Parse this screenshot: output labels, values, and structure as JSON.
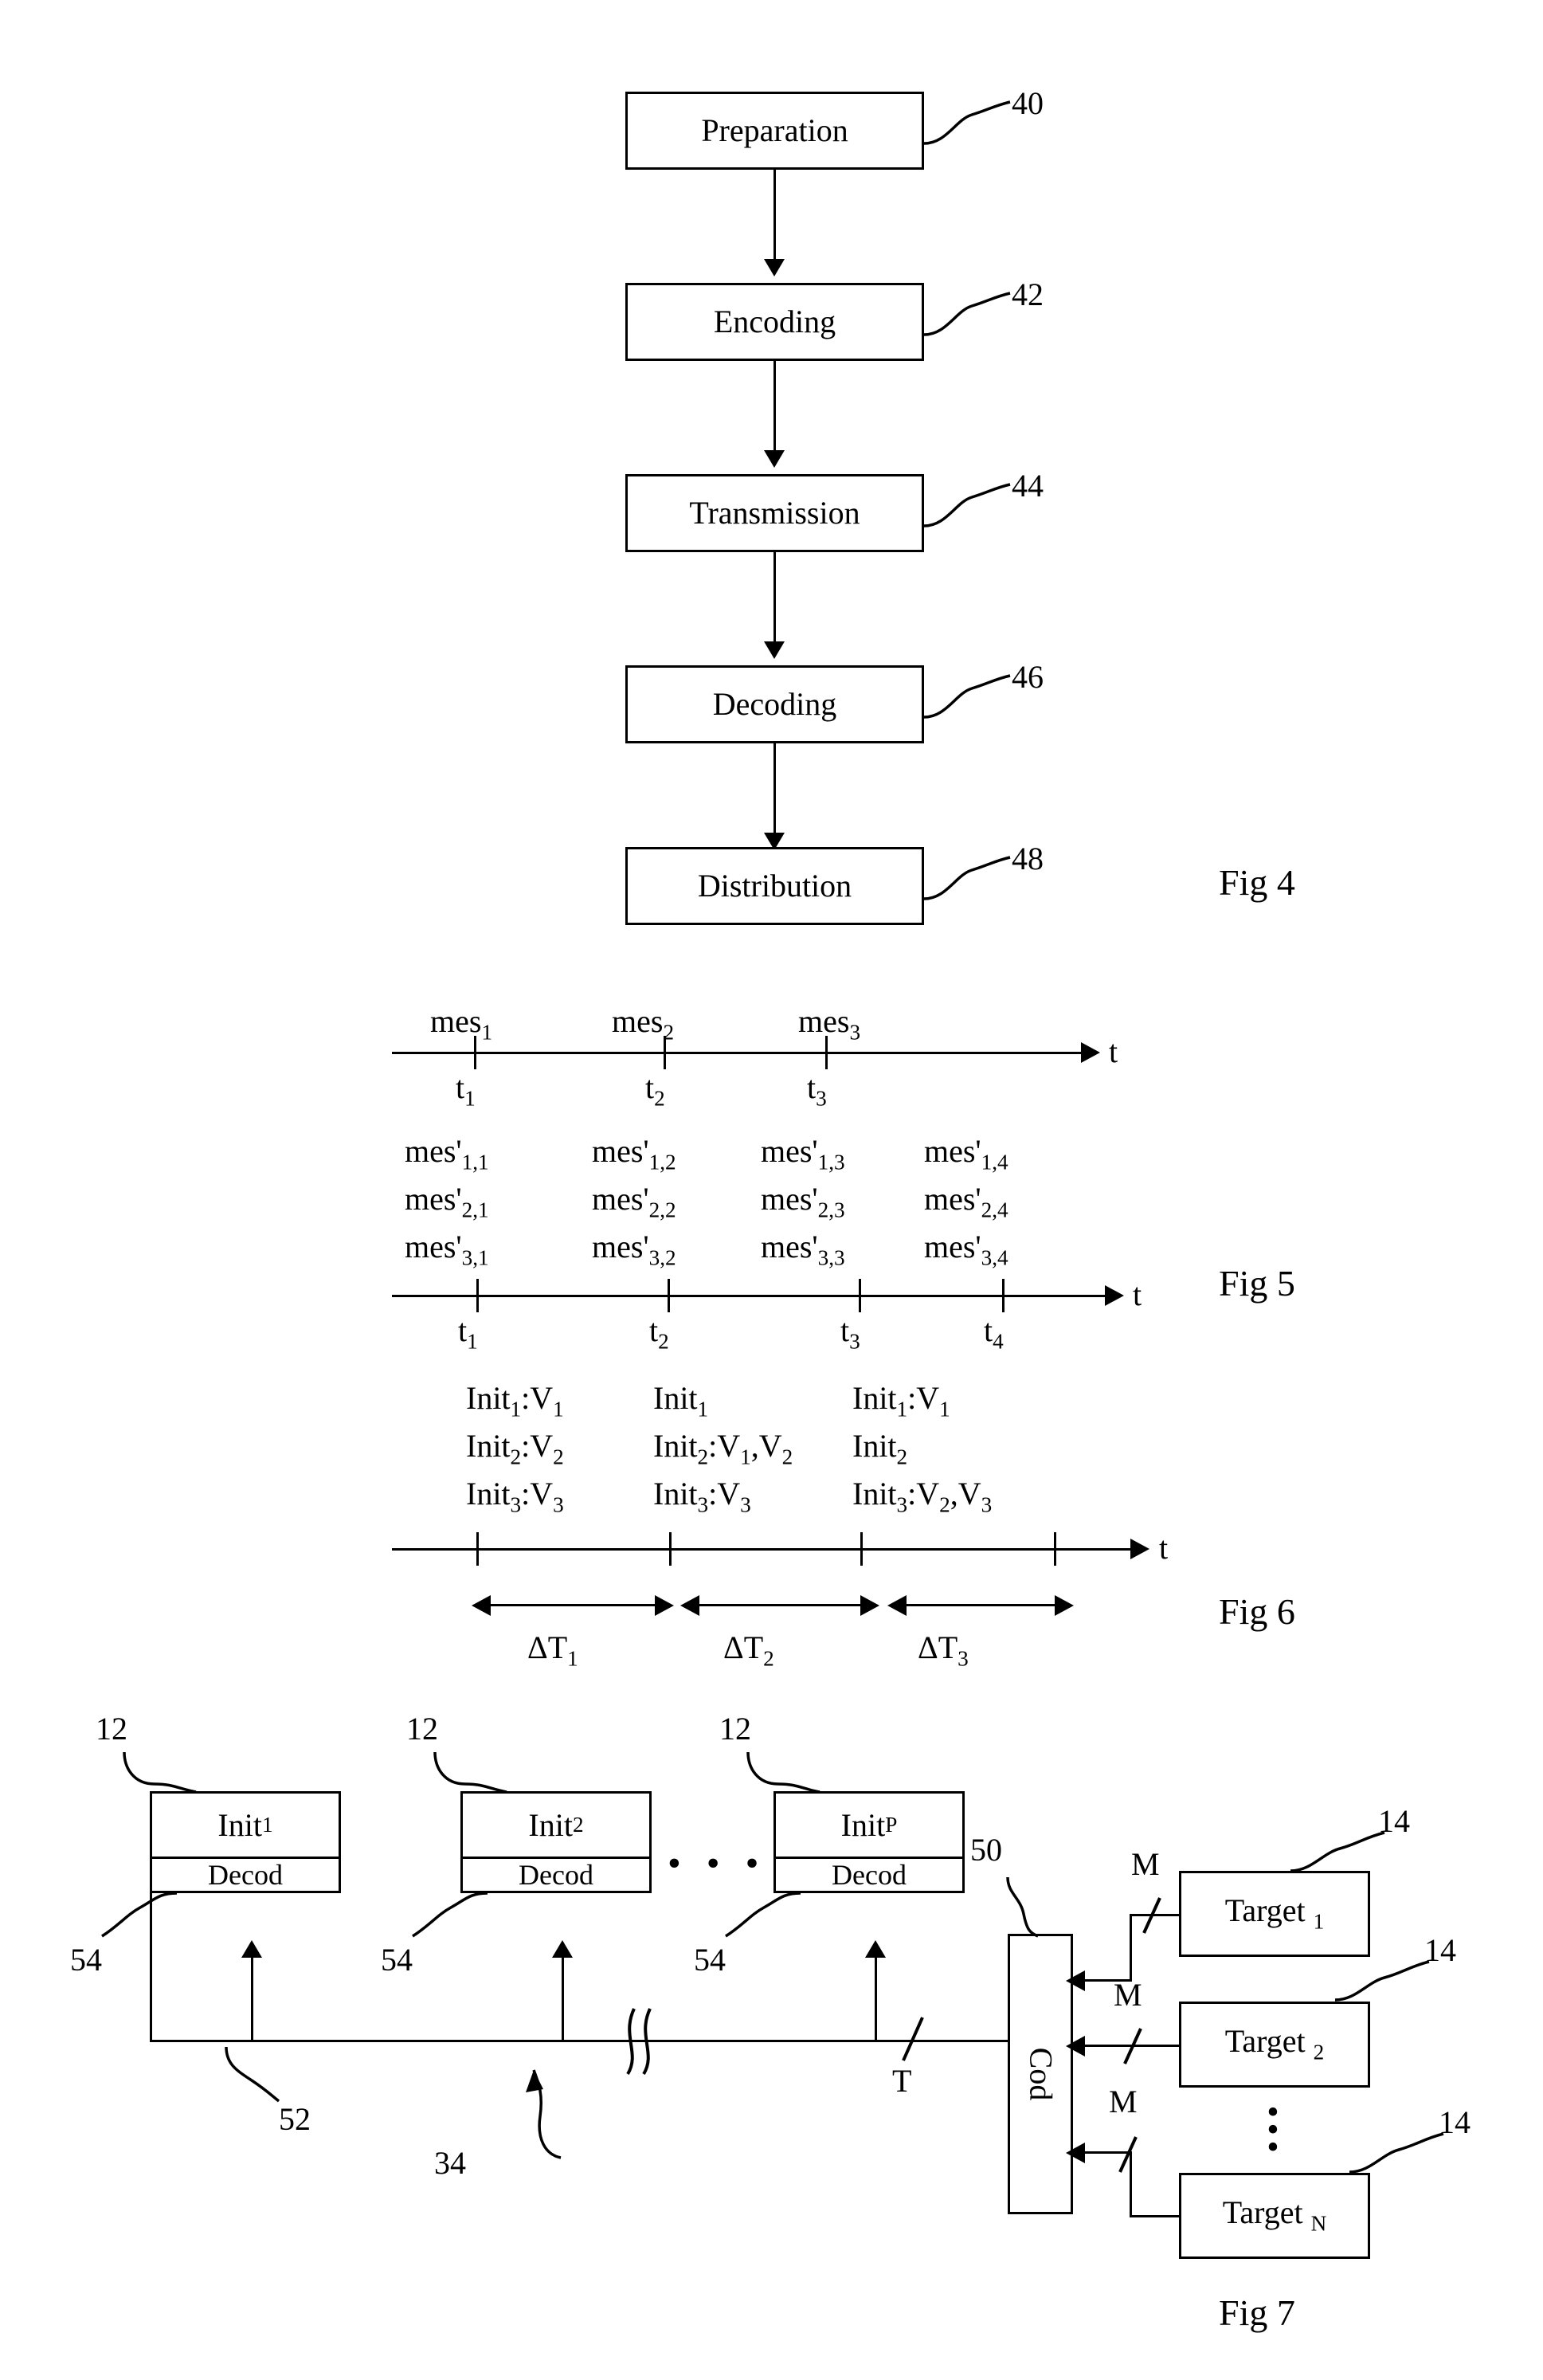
{
  "figures": {
    "fig4": {
      "label": "Fig 4",
      "steps": [
        {
          "name": "Preparation",
          "ref": "40"
        },
        {
          "name": "Encoding",
          "ref": "42"
        },
        {
          "name": "Transmission",
          "ref": "44"
        },
        {
          "name": "Decoding",
          "ref": "46"
        },
        {
          "name": "Distribution",
          "ref": "48"
        }
      ]
    },
    "fig5": {
      "label": "Fig 5",
      "axis_label": "t",
      "timeline_top": {
        "messages": [
          "mes",
          "mes",
          "mes"
        ],
        "message_subs": [
          "1",
          "2",
          "3"
        ],
        "ticks": [
          "t",
          "t",
          "t"
        ],
        "tick_subs": [
          "1",
          "2",
          "3"
        ]
      },
      "timeline_bottom": {
        "rows": [
          [
            "mes'",
            "mes'",
            "mes'",
            "mes'"
          ],
          [
            "mes'",
            "mes'",
            "mes'",
            "mes'"
          ],
          [
            "mes'",
            "mes'",
            "mes'",
            "mes'"
          ]
        ],
        "row_subs": [
          [
            "1,1",
            "1,2",
            "1,3",
            "1,4"
          ],
          [
            "2,1",
            "2,2",
            "2,3",
            "2,4"
          ],
          [
            "3,1",
            "3,2",
            "3,3",
            "3,4"
          ]
        ],
        "ticks": [
          "t",
          "t",
          "t",
          "t"
        ],
        "tick_subs": [
          "1",
          "2",
          "3",
          "4"
        ]
      }
    },
    "fig6": {
      "label": "Fig 6",
      "axis_label": "t",
      "columns": [
        {
          "entries": [
            {
              "name": "Init",
              "sub": "1",
              "values": ":V",
              "value_sub": "1"
            },
            {
              "name": "Init",
              "sub": "2",
              "values": ":V",
              "value_sub": "2"
            },
            {
              "name": "Init",
              "sub": "3",
              "values": ":V",
              "value_sub": "3"
            }
          ]
        },
        {
          "entries": [
            {
              "name": "Init",
              "sub": "1",
              "values": "",
              "value_sub": ""
            },
            {
              "name": "Init",
              "sub": "2",
              "values": ":V",
              "value_sub": "1",
              "extra": ",V",
              "extra_sub": "2"
            },
            {
              "name": "Init",
              "sub": "3",
              "values": ":V",
              "value_sub": "3"
            }
          ]
        },
        {
          "entries": [
            {
              "name": "Init",
              "sub": "1",
              "values": ":V",
              "value_sub": "1"
            },
            {
              "name": "Init",
              "sub": "2",
              "values": "",
              "value_sub": ""
            },
            {
              "name": "Init",
              "sub": "3",
              "values": ":V",
              "value_sub": "2",
              "extra": ",V",
              "extra_sub": "3"
            }
          ]
        }
      ],
      "intervals": [
        {
          "name": "ΔT",
          "sub": "1"
        },
        {
          "name": "ΔT",
          "sub": "2"
        },
        {
          "name": "ΔT",
          "sub": "3"
        }
      ]
    },
    "fig7": {
      "label": "Fig 7",
      "init_blocks": [
        {
          "title": "Init",
          "sub": "1",
          "lower": "Decod",
          "ref_top": "12",
          "ref_bottom": "54"
        },
        {
          "title": "Init",
          "sub": "2",
          "lower": "Decod",
          "ref_top": "12",
          "ref_bottom": "54"
        },
        {
          "title": "Init",
          "sub": "P",
          "lower": "Decod",
          "ref_top": "12",
          "ref_bottom": "54"
        }
      ],
      "ellipsis": "• • • •",
      "coder": {
        "label": "Cod",
        "ref": "50"
      },
      "bus": {
        "ref_left": "52",
        "ref_center": "34",
        "signal_label": "T"
      },
      "target_blocks": [
        {
          "title": "Target",
          "sub": "1",
          "ref": "14",
          "signal": "M"
        },
        {
          "title": "Target",
          "sub": "2",
          "ref": "14",
          "signal": "M"
        },
        {
          "title": "Target",
          "sub": "N",
          "ref": "14",
          "signal": "M"
        }
      ],
      "vertical_dots": "•\n•\n•"
    }
  }
}
